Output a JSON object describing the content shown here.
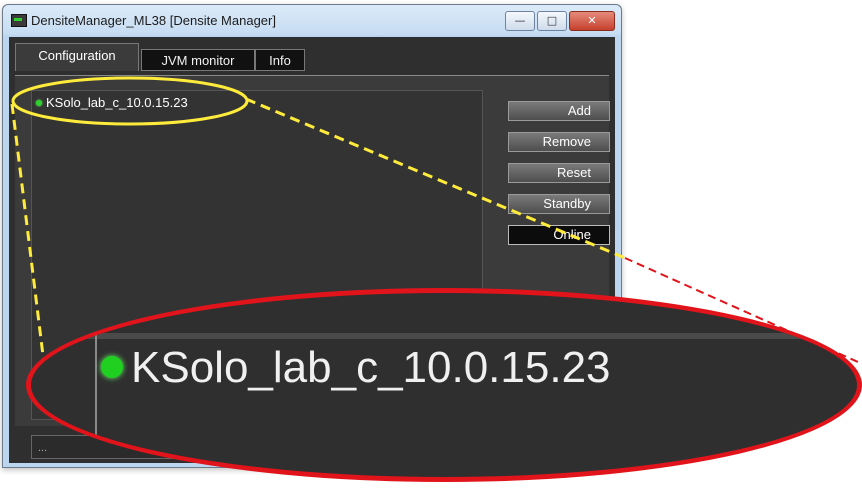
{
  "window": {
    "title": "DensiteManager_ML38 [Densite Manager]",
    "controls": {
      "minimize": "—",
      "maximize": "□",
      "close": "✕"
    }
  },
  "tabs": [
    {
      "label": "Configuration",
      "active": true
    },
    {
      "label": "JVM monitor",
      "active": false
    },
    {
      "label": "Info",
      "active": false
    }
  ],
  "tree": {
    "items": [
      {
        "label": "KSolo_lab_c_10.0.15.23",
        "status_color": "#2dd12d"
      }
    ]
  },
  "buttons": {
    "add": "Add",
    "remove": "Remove",
    "reset": "Reset",
    "standby": "Standby",
    "online": "Online"
  },
  "status": {
    "text": "..."
  },
  "callout": {
    "label": "KSolo_lab_c_10.0.15.23",
    "highlight_color": "#ffeb3b",
    "zoom_border_color": "#e0141a"
  }
}
